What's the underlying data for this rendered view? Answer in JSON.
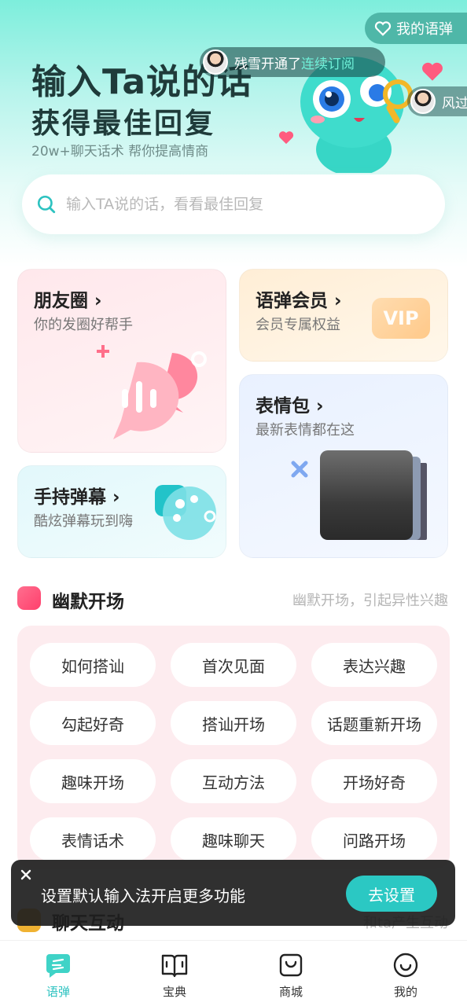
{
  "header": {
    "favorites_label": "我的语弹",
    "title_line1": "输入Ta说的话",
    "title_line2": "获得最佳回复",
    "subtitle": "20w+聊天话术 帮你提高情商"
  },
  "notices": [
    {
      "user": "残雪",
      "text": "开通了",
      "link": "连续订阅"
    },
    {
      "user": "风过"
    }
  ],
  "search": {
    "placeholder": "输入TA说的话，看看最佳回复"
  },
  "cards": {
    "moments": {
      "title": "朋友圈",
      "subtitle": "你的发圈好帮手"
    },
    "vip": {
      "title": "语弹会员",
      "subtitle": "会员专属权益",
      "badge": "VIP"
    },
    "emoji": {
      "title": "表情包",
      "subtitle": "最新表情都在这"
    },
    "danmu": {
      "title": "手持弹幕",
      "subtitle": "酷炫弹幕玩到嗨"
    }
  },
  "section_humor": {
    "title": "幽默开场",
    "hint": "幽默开场，引起异性兴趣",
    "chips": [
      "如何搭讪",
      "首次见面",
      "表达兴趣",
      "勾起好奇",
      "搭讪开场",
      "话题重新开场",
      "趣味开场",
      "互动方法",
      "开场好奇",
      "表情话术",
      "趣味聊天",
      "问路开场"
    ]
  },
  "section_chat": {
    "title": "聊天互动",
    "hint": "和ta产生互动"
  },
  "toast": {
    "text": "设置默认输入法开启更多功能",
    "button": "去设置"
  },
  "tabs": [
    {
      "label": "语弹",
      "active": true
    },
    {
      "label": "宝典",
      "active": false
    },
    {
      "label": "商城",
      "active": false
    },
    {
      "label": "我的",
      "active": false
    }
  ],
  "colors": {
    "accent": "#2cc2c0",
    "pink": "#ff4f78",
    "header_dark": "#1f3b3a"
  }
}
